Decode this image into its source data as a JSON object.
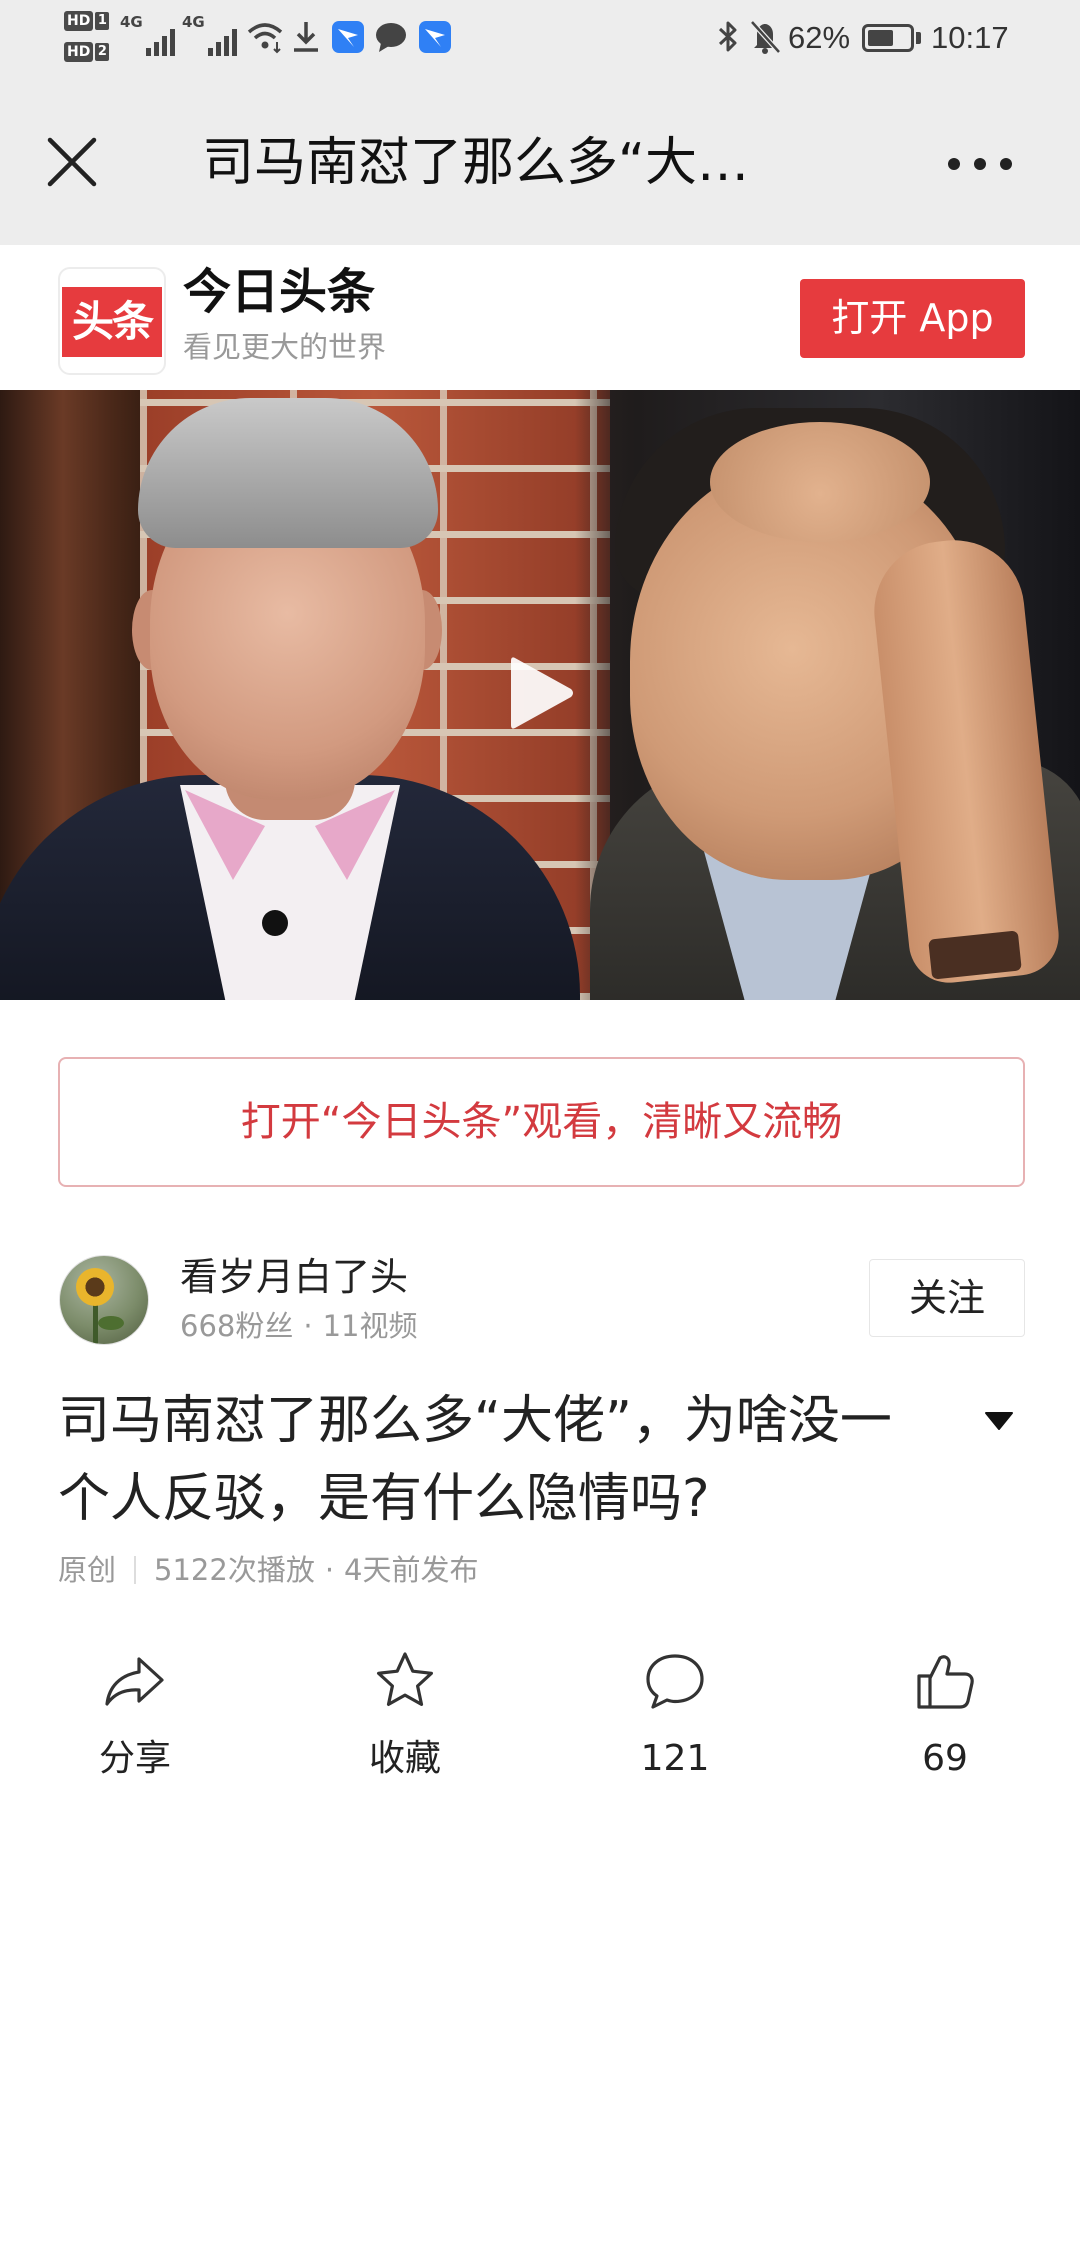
{
  "status_bar": {
    "hd_badges": [
      {
        "label": "HD",
        "slot": "1"
      },
      {
        "label": "HD",
        "slot": "2"
      }
    ],
    "network_types": [
      "4G",
      "4G"
    ],
    "battery_percent": "62%",
    "time": "10:17",
    "icons": {
      "left": [
        "signal-bars-icon",
        "signal-bars-icon",
        "wifi-icon",
        "download-icon",
        "app-notification-icon",
        "message-bubble-icon",
        "app-notification-icon"
      ],
      "right": [
        "bluetooth-icon",
        "bell-muted-icon",
        "battery-icon"
      ]
    }
  },
  "title_bar": {
    "title": "司马南怼了那么多“大…",
    "icons": {
      "close": "close-icon",
      "more": "more-dots-icon"
    }
  },
  "app_banner": {
    "logo_text": "头条",
    "app_name": "今日头条",
    "slogan": "看见更大的世界",
    "open_button": "打开 App"
  },
  "video": {
    "icons": {
      "play": "play-icon"
    }
  },
  "open_in_app_prompt": "打开“今日头条”观看，清晰又流畅",
  "author": {
    "name": "看岁月白了头",
    "fans": "668粉丝",
    "separator": "·",
    "videos": "11视频",
    "follow_button": "关注"
  },
  "article": {
    "title": "司马南怼了那么多“大佬”，为啥没一个人反驳，是有什么隐情吗?",
    "original_tag": "原创",
    "plays": "5122次播放",
    "separator": "·",
    "published": "4天前发布",
    "icons": {
      "expand": "caret-down-icon"
    }
  },
  "actions": [
    {
      "icon": "share-icon",
      "label": "分享"
    },
    {
      "icon": "star-icon",
      "label": "收藏"
    },
    {
      "icon": "comment-icon",
      "label": "121"
    },
    {
      "icon": "thumbs-up-icon",
      "label": "69"
    }
  ],
  "colors": {
    "brand_red": "#e63b3e",
    "prompt_red": "#d33a3f",
    "bar_bg": "#ededed",
    "text_main": "#222222",
    "text_muted": "#999999",
    "app_icon_blue": "#2f80f5"
  }
}
